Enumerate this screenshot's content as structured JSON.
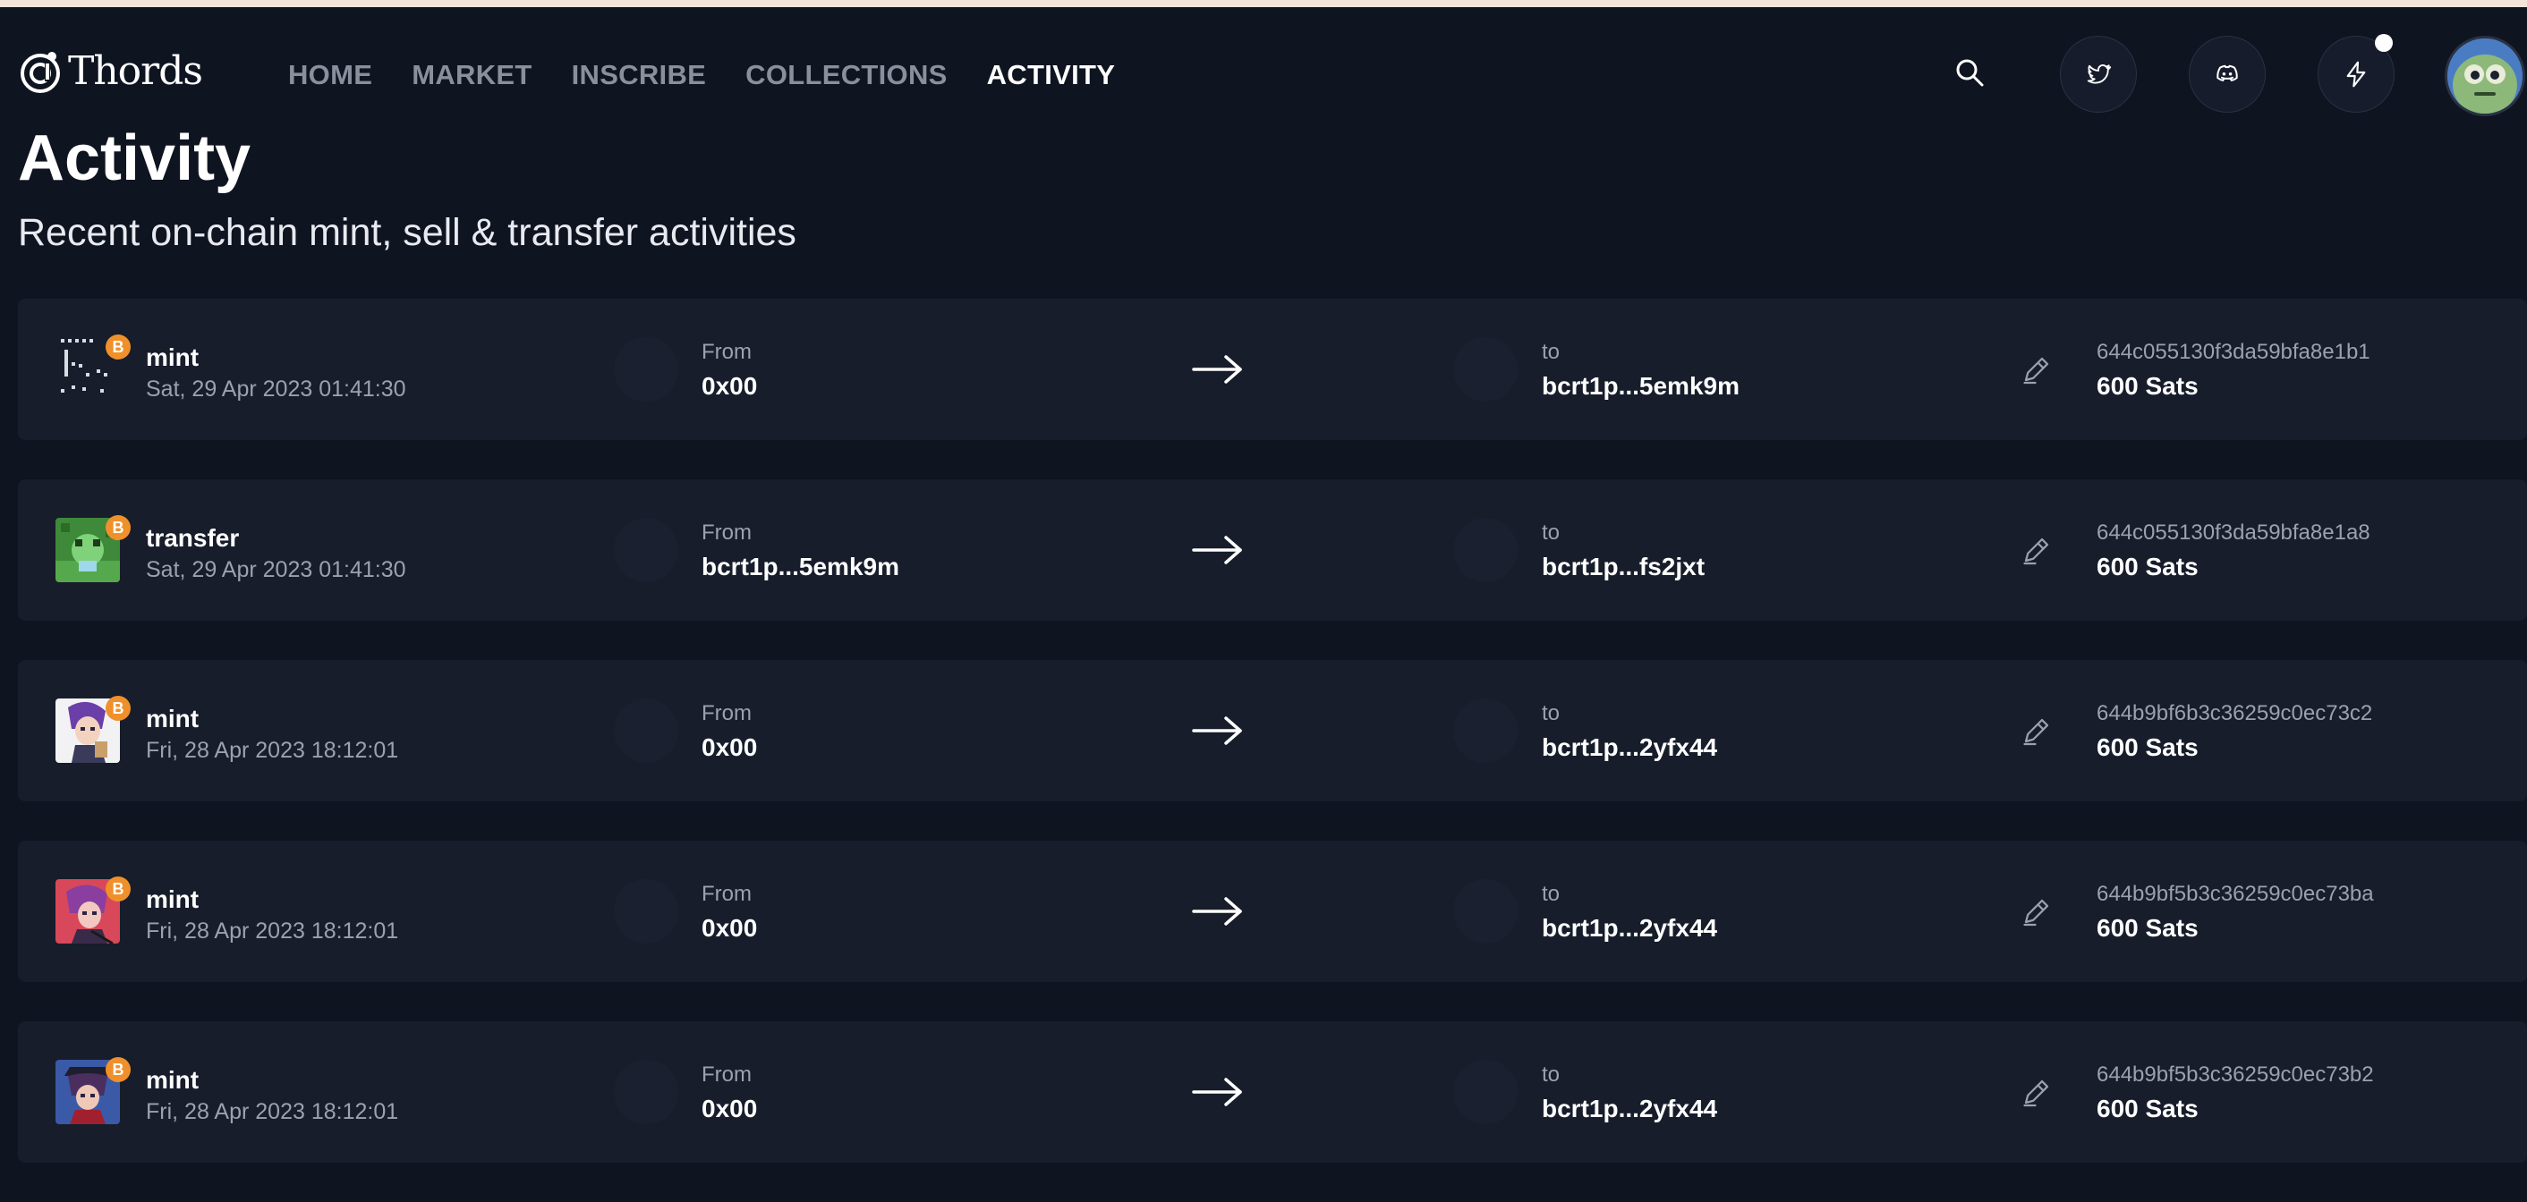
{
  "brand": {
    "name": "Thords"
  },
  "nav": {
    "items": [
      {
        "label": "HOME",
        "active": false
      },
      {
        "label": "MARKET",
        "active": false
      },
      {
        "label": "INSCRIBE",
        "active": false
      },
      {
        "label": "COLLECTIONS",
        "active": false
      },
      {
        "label": "ACTIVITY",
        "active": true
      }
    ]
  },
  "header": {
    "icons": [
      "search-icon",
      "twitter-icon",
      "discord-icon",
      "lightning-icon"
    ],
    "notification_dot_color": "#ffffff"
  },
  "page": {
    "title": "Activity",
    "subtitle": "Recent on-chain mint, sell & transfer activities"
  },
  "colors": {
    "background": "#0f1421",
    "row_background": "#171d2b",
    "muted_text": "#9ca1ad",
    "bitcoin_badge": "#f0902a"
  },
  "activities": [
    {
      "type": "mint",
      "time": "Sat, 29 Apr 2023 01:41:30",
      "from_label": "From",
      "from": "0x00",
      "to_label": "to",
      "to": "bcrt1p...5emk9m",
      "hash": "644c055130f3da59bfa8e1b1",
      "price": "600 Sats",
      "badge": "B"
    },
    {
      "type": "transfer",
      "time": "Sat, 29 Apr 2023 01:41:30",
      "from_label": "From",
      "from": "bcrt1p...5emk9m",
      "to_label": "to",
      "to": "bcrt1p...fs2jxt",
      "hash": "644c055130f3da59bfa8e1a8",
      "price": "600 Sats",
      "badge": "B"
    },
    {
      "type": "mint",
      "time": "Fri, 28 Apr 2023 18:12:01",
      "from_label": "From",
      "from": "0x00",
      "to_label": "to",
      "to": "bcrt1p...2yfx44",
      "hash": "644b9bf6b3c36259c0ec73c2",
      "price": "600 Sats",
      "badge": "B"
    },
    {
      "type": "mint",
      "time": "Fri, 28 Apr 2023 18:12:01",
      "from_label": "From",
      "from": "0x00",
      "to_label": "to",
      "to": "bcrt1p...2yfx44",
      "hash": "644b9bf5b3c36259c0ec73ba",
      "price": "600 Sats",
      "badge": "B"
    },
    {
      "type": "mint",
      "time": "Fri, 28 Apr 2023 18:12:01",
      "from_label": "From",
      "from": "0x00",
      "to_label": "to",
      "to": "bcrt1p...2yfx44",
      "hash": "644b9bf5b3c36259c0ec73b2",
      "price": "600 Sats",
      "badge": "B"
    }
  ]
}
